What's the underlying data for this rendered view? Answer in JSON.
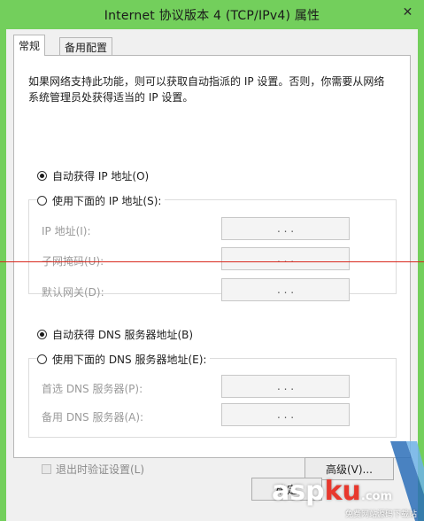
{
  "window": {
    "title": "Internet 协议版本 4 (TCP/IPv4) 属性",
    "close_glyph": "✕"
  },
  "tabs": [
    {
      "label": "常规",
      "active": true
    },
    {
      "label": "备用配置",
      "active": false
    }
  ],
  "description": "如果网络支持此功能，则可以获取自动指派的 IP 设置。否则，你需要从网络系统管理员处获得适当的 IP 设置。",
  "ip_section": {
    "auto_label": "自动获得 IP 地址(O)",
    "manual_label": "使用下面的 IP 地址(S):",
    "selected": "auto",
    "fields": [
      {
        "label": "IP 地址(I):",
        "value": ".   .   ."
      },
      {
        "label": "子网掩码(U):",
        "value": ".   .   ."
      },
      {
        "label": "默认网关(D):",
        "value": ".   .   ."
      }
    ]
  },
  "dns_section": {
    "auto_label": "自动获得 DNS 服务器地址(B)",
    "manual_label": "使用下面的 DNS 服务器地址(E):",
    "selected": "auto",
    "fields": [
      {
        "label": "首选 DNS 服务器(P):",
        "value": ".   .   ."
      },
      {
        "label": "备用 DNS 服务器(A):",
        "value": ".   .   ."
      }
    ]
  },
  "validate_checkbox": {
    "label": "退出时验证设置(L)",
    "checked": false
  },
  "advanced_button": "高级(V)...",
  "ok_button": "确定",
  "watermark": {
    "main_a": "asp",
    "main_b": "ku",
    "main_c": ".com",
    "sub": "免费网站源码下载站"
  },
  "colors": {
    "window_frame": "#73cf5c",
    "annotation_line": "#d9281d"
  }
}
